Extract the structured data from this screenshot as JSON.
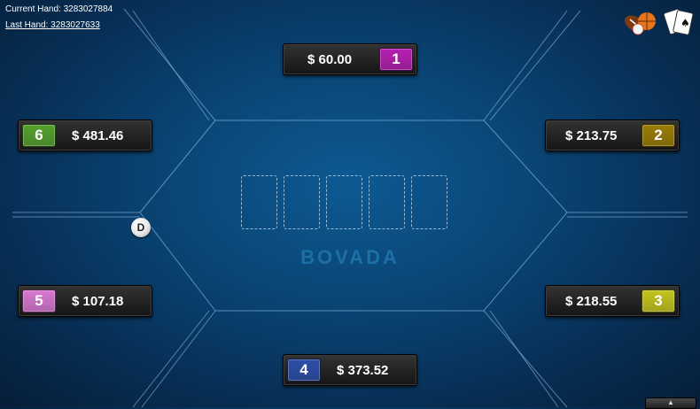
{
  "hand_info": {
    "current": "Current Hand: 3283027884",
    "last": "Last Hand: 3283027633"
  },
  "icons": {
    "sports": "sports-balls-icon",
    "cards": "playing-cards-icon"
  },
  "table": {
    "logo": "BOVADA",
    "dealer_label": "D",
    "expand_icon": "chevron-up-icon"
  },
  "seats": [
    {
      "number": "1",
      "amount": "$ 60.00",
      "color": "#b51fb0"
    },
    {
      "number": "2",
      "amount": "$ 213.75",
      "color": "#9a7c07"
    },
    {
      "number": "3",
      "amount": "$ 218.55",
      "color": "#c3c51d"
    },
    {
      "number": "4",
      "amount": "$ 373.52",
      "color": "#2c4ea8"
    },
    {
      "number": "5",
      "amount": "$ 107.18",
      "color": "#d978d3"
    },
    {
      "number": "6",
      "amount": "$ 481.46",
      "color": "#55a12d"
    }
  ]
}
